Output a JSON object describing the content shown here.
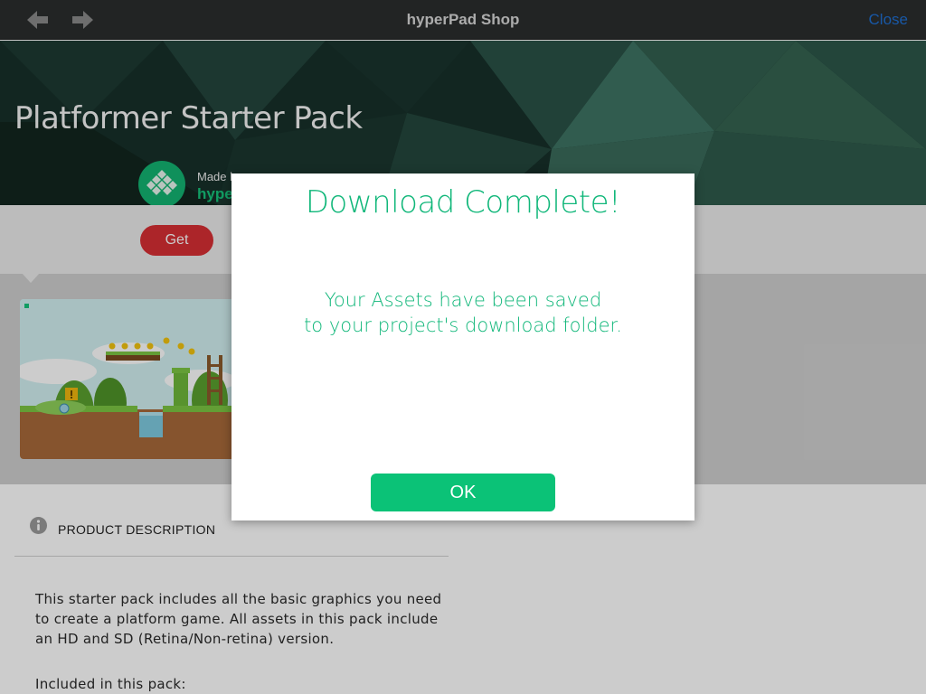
{
  "navbar": {
    "title": "hyperPad Shop",
    "close_label": "Close"
  },
  "product": {
    "title": "Platformer Starter Pack",
    "made_by_label": "Made by",
    "creator": "hyperPad",
    "get_label": "Get"
  },
  "description": {
    "header": "PRODUCT DESCRIPTION",
    "body": "This starter pack includes all the basic graphics you need to create a platform game. All assets in this pack include an HD and SD (Retina/Non-retina) version.",
    "included_label": "Included in this pack:"
  },
  "modal": {
    "title": "Download Complete!",
    "message_line1": "Your Assets have been saved",
    "message_line2": "to your project's download folder.",
    "ok_label": "OK"
  },
  "colors": {
    "accent_green": "#0bc277",
    "get_red": "#d82f34",
    "close_blue": "#1f6fd1",
    "nav_bg": "#2b2d2d"
  },
  "icons": {
    "back": "arrow-left-icon",
    "forward": "arrow-right-icon",
    "info": "info-icon",
    "creator_logo": "hyperpad-logo-icon"
  }
}
